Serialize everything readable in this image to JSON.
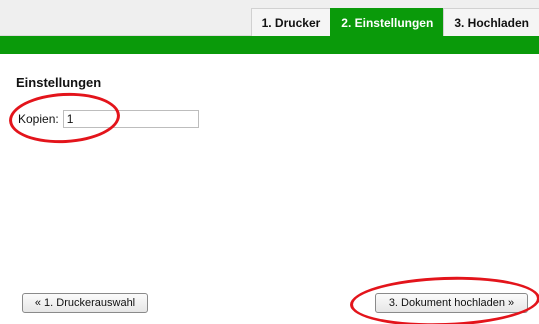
{
  "tabs": [
    {
      "label": "1. Drucker",
      "active": false
    },
    {
      "label": "2. Einstellungen",
      "active": true
    },
    {
      "label": "3. Hochladen",
      "active": false
    }
  ],
  "section": {
    "title": "Einstellungen"
  },
  "copies": {
    "label": "Kopien:",
    "value": "1"
  },
  "buttons": {
    "back_label": "« 1. Druckerauswahl",
    "next_label": "3. Dokument hochladen »"
  },
  "colors": {
    "accent": "#0a9a0a",
    "highlight": "#e3141b"
  }
}
